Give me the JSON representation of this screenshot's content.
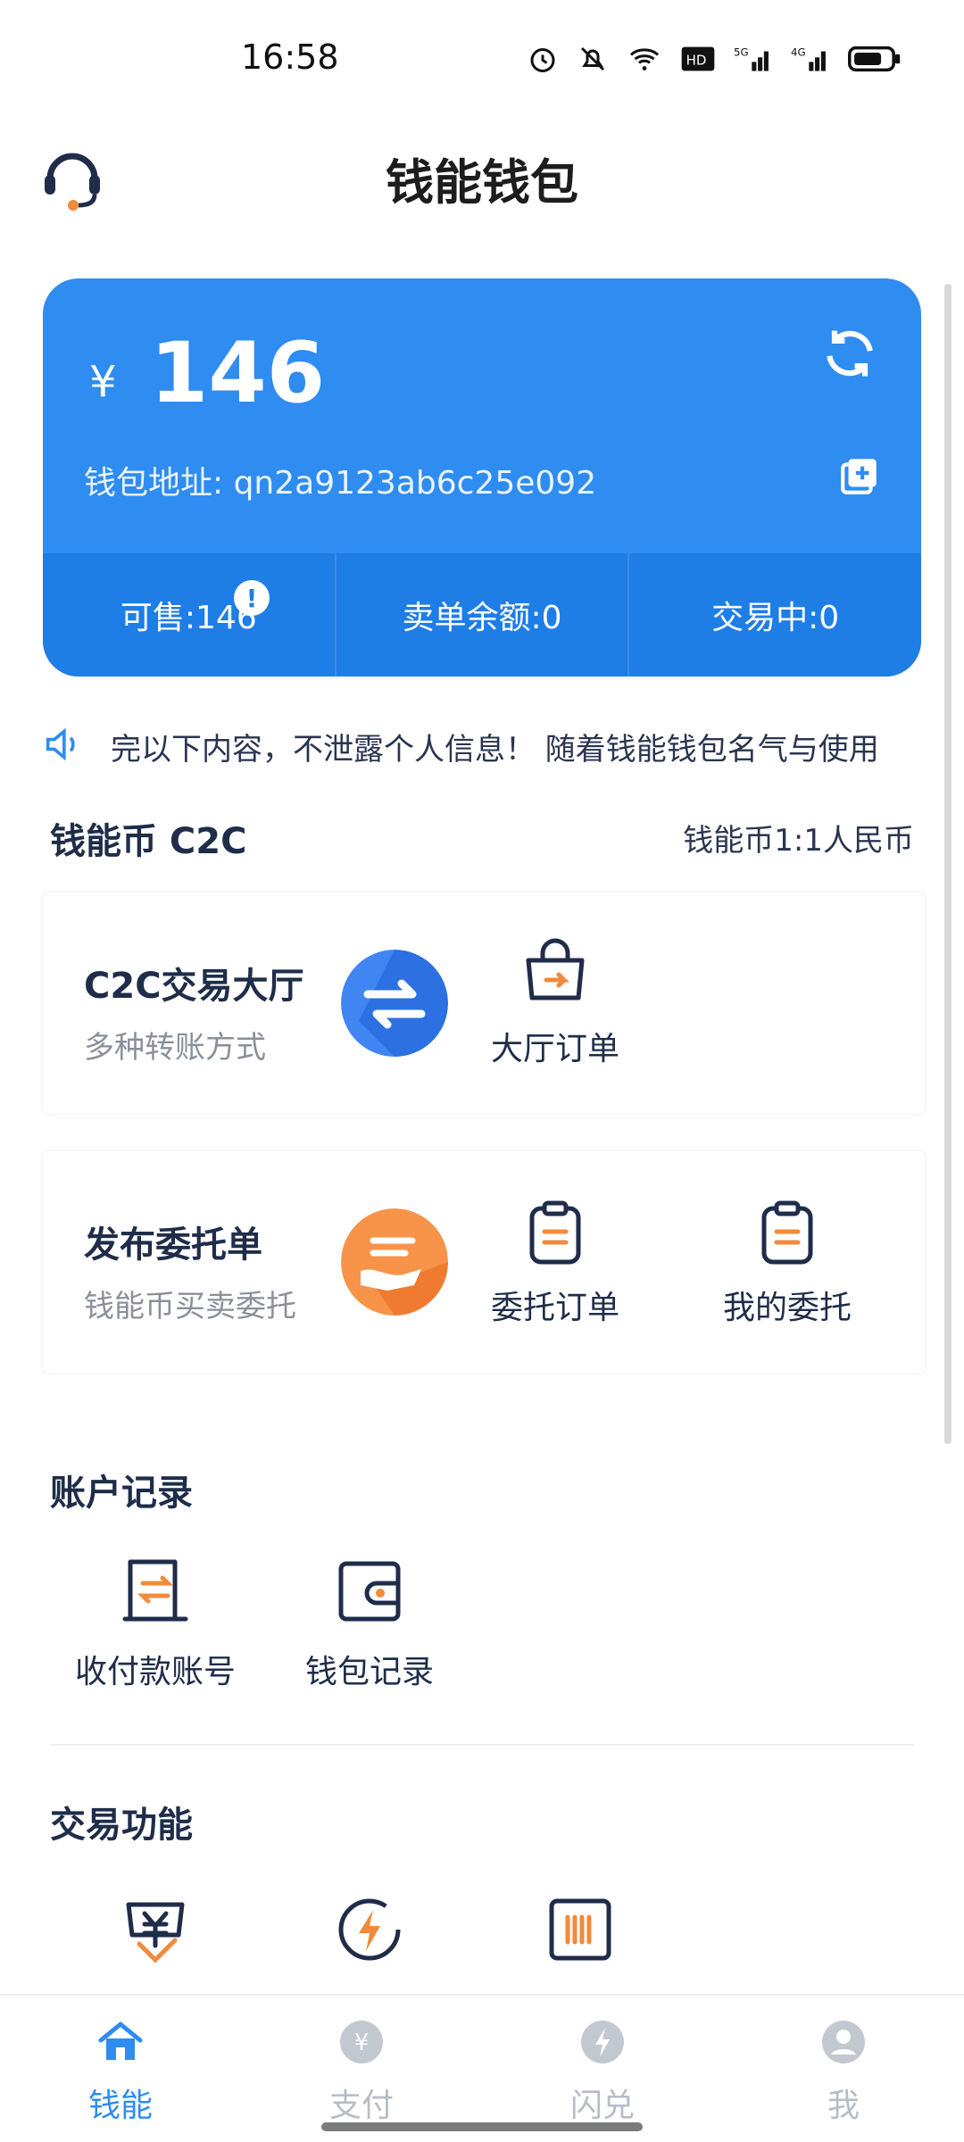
{
  "status": {
    "time": "16:58"
  },
  "header": {
    "title": "钱能钱包"
  },
  "balance": {
    "currency": "¥",
    "amount": "146",
    "address": "钱包地址: qn2a9123ab6c25e092",
    "footer": {
      "sellable": "可售:146",
      "sell_balance": "卖单余额:0",
      "trading": "交易中:0"
    },
    "info_badge": "!"
  },
  "notice": {
    "text": "完以下内容，不泄露个人信息！ 随着钱能钱包名气与使用"
  },
  "c2c": {
    "title": "钱能币 C2C",
    "rate": "钱能币1:1人民币",
    "hall": {
      "title": "C2C交易大厅",
      "subtitle": "多种转账方式",
      "order_label": "大厅订单"
    },
    "entrust": {
      "title": "发布委托单",
      "subtitle": "钱能币买卖委托",
      "orders_label": "委托订单",
      "my_label": "我的委托"
    }
  },
  "account": {
    "title": "账户记录",
    "items": [
      "收付款账号",
      "钱包记录"
    ]
  },
  "trade": {
    "title": "交易功能"
  },
  "nav": {
    "items": [
      "钱能",
      "支付",
      "闪兑",
      "我"
    ]
  },
  "colors": {
    "primary": "#2f8cf0",
    "primary_dark": "#1f7de6",
    "accent_orange": "#f08a3c",
    "text_dark": "#1f2d4a"
  }
}
